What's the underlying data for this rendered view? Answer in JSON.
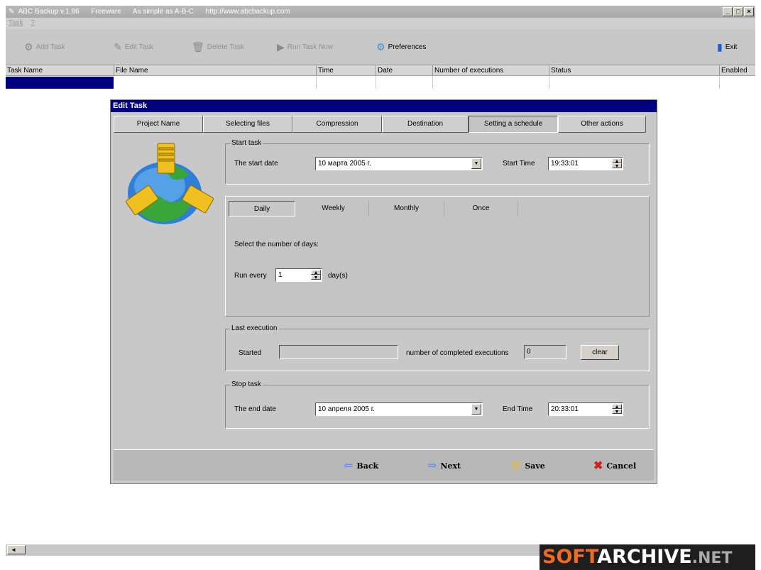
{
  "window": {
    "title_parts": [
      "ABC Backup v.1.86",
      "Freeware",
      "As simple as A-B-C",
      "http://www.abcbackup.com"
    ],
    "buttons": {
      "minimize": "_",
      "maximize": "□",
      "close": "×"
    }
  },
  "menu": {
    "items": [
      "Task",
      "?"
    ]
  },
  "toolbar": {
    "add_task": "Add Task",
    "edit_task": "Edit Task",
    "delete_task": "Delete Task",
    "run_task_now": "Run Task Now",
    "preferences": "Preferences",
    "exit": "Exit"
  },
  "grid": {
    "columns": [
      "Task Name",
      "File Name",
      "Time",
      "Date",
      "Number of executions",
      "Status",
      "Enabled"
    ]
  },
  "dialog": {
    "title": "Edit Task",
    "tabs": [
      "Project Name",
      "Selecting files",
      "Compression",
      "Destination",
      "Setting a schedule",
      "Other actions"
    ],
    "active_tab": "Setting a schedule",
    "start_task": {
      "legend": "Start task",
      "date_label": "The start date",
      "date_value": "10   марта   2005 г.",
      "time_label": "Start Time",
      "time_value": "19:33:01"
    },
    "frequency": {
      "tabs": [
        "Daily",
        "Weekly",
        "Monthly",
        "Once"
      ],
      "active": "Daily",
      "instruction": "Select the number of days:",
      "run_every_label": "Run every",
      "run_every_value": "1",
      "unit": "day(s)"
    },
    "last_execution": {
      "legend": "Last execution",
      "started_label": "Started",
      "started_value": "",
      "completed_label": "number of completed executions",
      "completed_value": "0",
      "clear_button": "clear"
    },
    "stop_task": {
      "legend": "Stop task",
      "date_label": "The end date",
      "date_value": "10   апреля   2005 г.",
      "time_label": "End Time",
      "time_value": "20:33:01"
    },
    "footer": {
      "back": "Back",
      "next": "Next",
      "save": "Save",
      "cancel": "Cancel"
    }
  },
  "watermark": {
    "part1": "SOFT",
    "part2": "ARCHIVE",
    "part3": ".NET"
  },
  "scroll": {
    "left_arrow": "◄"
  },
  "colors": {
    "dialog_title": "#000080",
    "selection": "#000080",
    "watermark_orange": "#f26a21"
  }
}
